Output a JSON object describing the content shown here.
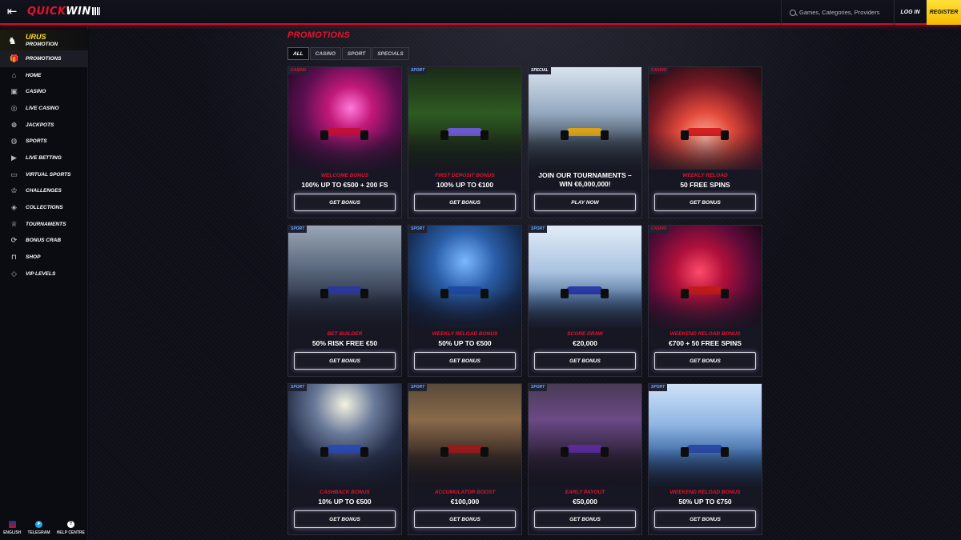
{
  "header": {
    "logo_quick": "QUICK",
    "logo_win": "WIN",
    "search_placeholder": "Games, Categories, Providers",
    "login_label": "LOG IN",
    "register_label": "REGISTER"
  },
  "sidebar": {
    "promo_title": "URUS",
    "promo_subtitle": "PROMOTION",
    "items": [
      {
        "label": "PROMOTIONS",
        "icon": "gift-icon",
        "glyph": "🎁"
      },
      {
        "label": "HOME",
        "icon": "home-icon",
        "glyph": "⌂"
      },
      {
        "label": "CASINO",
        "icon": "slot-machine-icon",
        "glyph": "▣"
      },
      {
        "label": "LIVE CASINO",
        "icon": "chip-icon",
        "glyph": "◎"
      },
      {
        "label": "JACKPOTS",
        "icon": "globe-icon",
        "glyph": "⊕"
      },
      {
        "label": "SPORTS",
        "icon": "ball-icon",
        "glyph": "◍"
      },
      {
        "label": "LIVE BETTING",
        "icon": "video-icon",
        "glyph": "▶"
      },
      {
        "label": "VIRTUAL SPORTS",
        "icon": "monitor-icon",
        "glyph": "▭"
      },
      {
        "label": "CHALLENGES",
        "icon": "medal-icon",
        "glyph": "♔"
      },
      {
        "label": "COLLECTIONS",
        "icon": "collections-icon",
        "glyph": "◈"
      },
      {
        "label": "TOURNAMENTS",
        "icon": "trophy-icon",
        "glyph": "♕"
      },
      {
        "label": "BONUS CRAB",
        "icon": "crab-icon",
        "glyph": "⟳"
      },
      {
        "label": "SHOP",
        "icon": "bag-icon",
        "glyph": "⊓"
      },
      {
        "label": "VIP LEVELS",
        "icon": "diamond-icon",
        "glyph": "◇"
      }
    ],
    "footer": [
      {
        "label": "ENGLISH",
        "icon": "uk-flag-icon"
      },
      {
        "label": "TELEGRAM",
        "icon": "telegram-icon"
      },
      {
        "label": "HELP CENTRE",
        "icon": "help-icon"
      }
    ]
  },
  "main": {
    "title": "PROMOTIONS",
    "filters": [
      "ALL",
      "CASINO",
      "SPORT",
      "SPECIALS"
    ],
    "active_filter": "ALL",
    "cards": [
      {
        "badge": "CASINO",
        "kind": "WELCOME BONUS",
        "title": "100% UP TO €500 + 200 FS",
        "cta": "GET BONUS",
        "art": "art-casino-pink",
        "car": "#c0103a"
      },
      {
        "badge": "SPORT",
        "kind": "FIRST DEPOSIT BONUS",
        "title": "100% UP TO €100",
        "cta": "GET BONUS",
        "art": "art-sport-green",
        "car": "#6a5acd"
      },
      {
        "badge": "SPECIAL",
        "kind": "",
        "title": "JOIN OUR TOURNAMENTS – WIN €6,000,000!",
        "cta": "PLAY NOW",
        "art": "art-special",
        "car": "#d8a21a"
      },
      {
        "badge": "CASINO",
        "kind": "WEEKLY RELOAD",
        "title": "50 FREE SPINS",
        "cta": "GET BONUS",
        "art": "art-casino-red",
        "car": "#d42020"
      },
      {
        "badge": "SPORT",
        "kind": "BET BUILDER",
        "title": "50% RISK FREE €50",
        "cta": "GET BONUS",
        "art": "art-sport-factory",
        "car": "#2a3a9a"
      },
      {
        "badge": "SPORT",
        "kind": "WEEKLY RELOAD BONUS",
        "title": "50% UP TO €500",
        "cta": "GET BONUS",
        "art": "art-sport-blue",
        "car": "#1f4aa0"
      },
      {
        "badge": "SPORT",
        "kind": "SCORE DRAW",
        "title": "€20,000",
        "cta": "GET BONUS",
        "art": "art-sport-sky",
        "car": "#2a3aa8"
      },
      {
        "badge": "CASINO",
        "kind": "WEEKEND RELOAD BONUS",
        "title": "€700 + 50 FREE SPINS",
        "cta": "GET BONUS",
        "art": "art-casino-neon",
        "car": "#c01a1a"
      },
      {
        "badge": "SPORT",
        "kind": "CASHBACK BONUS",
        "title": "10% UP TO €500",
        "cta": "GET BONUS",
        "art": "art-sport-stadium",
        "car": "#2a4ab0"
      },
      {
        "badge": "SPORT",
        "kind": "ACCUMULATOR BOOST",
        "title": "€100,000",
        "cta": "GET BONUS",
        "art": "art-sport-street",
        "car": "#9a1a1a"
      },
      {
        "badge": "SPORT",
        "kind": "EARLY PAYOUT",
        "title": "€50,000",
        "cta": "GET BONUS",
        "art": "art-sport-purple",
        "car": "#5a2a9a"
      },
      {
        "badge": "SPORT",
        "kind": "WEEKEND RELOAD BONUS",
        "title": "50% UP TO €750",
        "cta": "GET BONUS",
        "art": "art-sport-clouds",
        "car": "#2a4aa8"
      }
    ]
  },
  "colors": {
    "accent_red": "#e8112d",
    "register_yellow": "#ffd21a",
    "badge_casino_text": "#e8112d",
    "badge_sport_text": "#6aa8ff",
    "badge_special_text": "#ffffff"
  }
}
